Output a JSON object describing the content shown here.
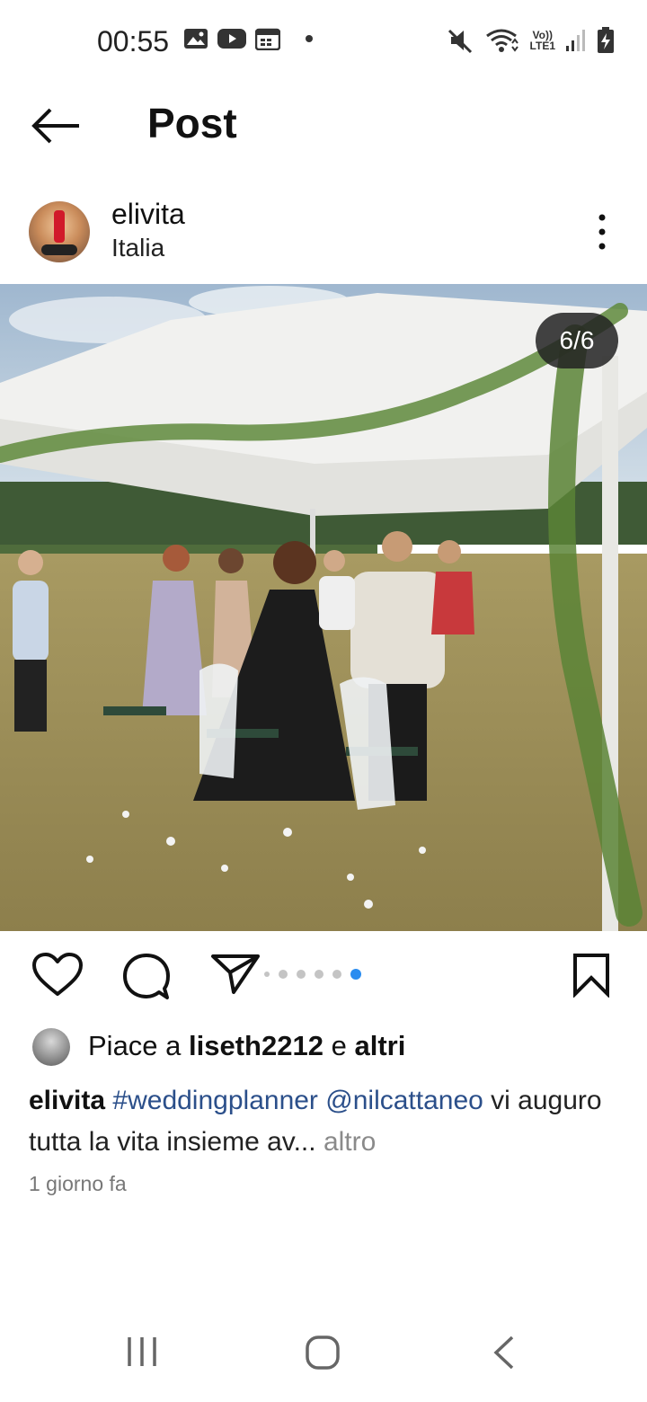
{
  "status_bar": {
    "time": "00:55",
    "left_icons": [
      "gallery-icon",
      "youtube-icon",
      "calendar-icon",
      "notification-dot-icon"
    ],
    "network_label_top": "Vo))",
    "network_label_bottom": "LTE1",
    "right_icons": [
      "mute-icon",
      "wifi-icon",
      "signal-icon",
      "battery-charging-icon"
    ]
  },
  "app_bar": {
    "title": "Post"
  },
  "post": {
    "username": "elivita",
    "location": "Italia",
    "page_counter": "6/6",
    "carousel": {
      "total": 6,
      "current": 6
    },
    "likes": {
      "prefix": "Piace a",
      "user": "liseth2212",
      "conjunction": "e",
      "others": "altri"
    },
    "caption": {
      "user": "elivita",
      "hashtag": "#weddingplanner",
      "mention": "@nilcattaneo",
      "text": " vi auguro tutta la vita insieme av...",
      "more": "altro"
    },
    "time_ago": "1 giorno fa"
  },
  "colors": {
    "accent_blue": "#2a8cf0",
    "link_blue": "#2b4f8a",
    "muted_grey": "#8a8a8a"
  }
}
